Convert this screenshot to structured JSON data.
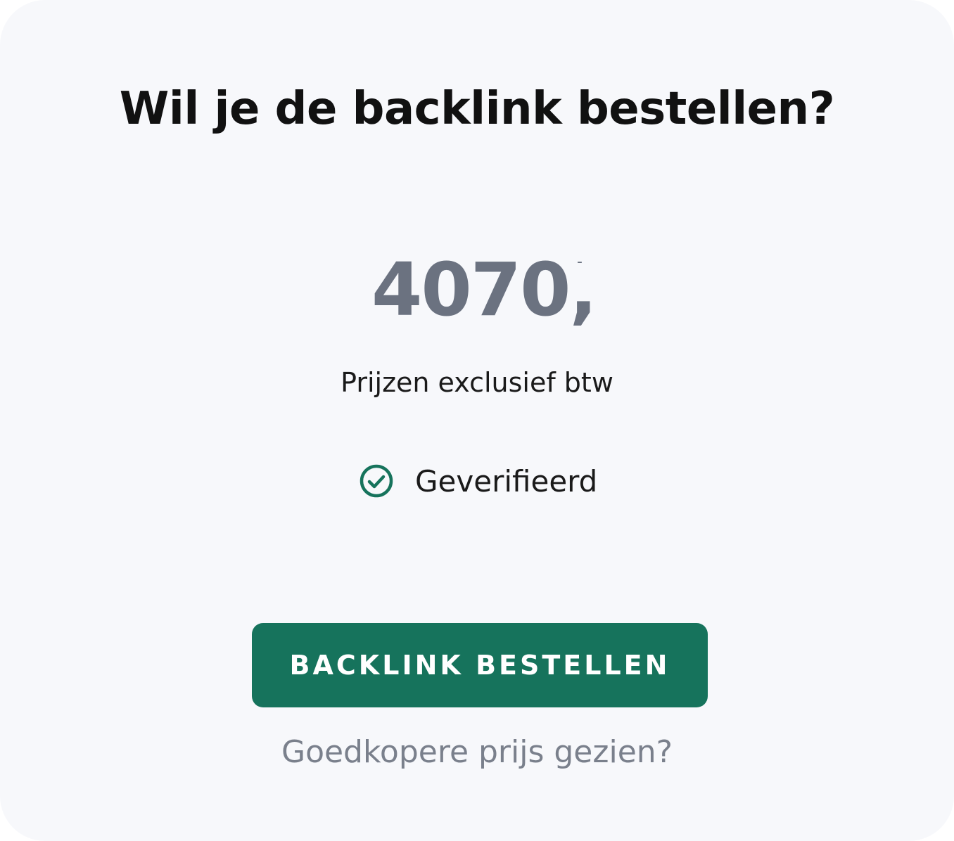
{
  "card": {
    "title": "Wil je de backlink bestellen?",
    "price": {
      "amount": "4070,",
      "suffix": "-"
    },
    "vat_note": "Prijzen exclusief btw",
    "verified": {
      "label": "Geverifieerd",
      "icon": "check-circle-icon"
    },
    "order_button_label": "BACKLINK BESTELLEN",
    "cheaper_price_link": "Goedkopere prijs gezien?"
  },
  "colors": {
    "accent": "#16735c",
    "price": "#6b7280",
    "background": "#f7f8fb"
  }
}
